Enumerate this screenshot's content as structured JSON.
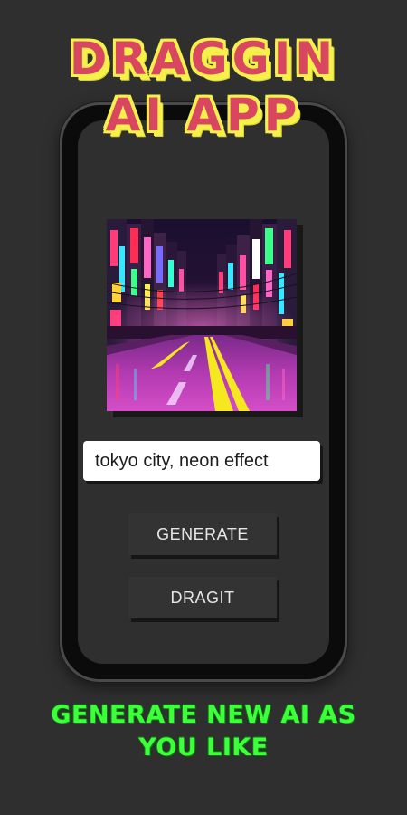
{
  "header": {
    "title_line_1": "DRAGGIN",
    "title_line_2": "AI APP",
    "title_color": "#d94660",
    "title_outline_color": "#f5f14a"
  },
  "preview": {
    "image_subject": "neon city street at night"
  },
  "prompt": {
    "value": "tokyo city, neon effect"
  },
  "buttons": {
    "generate_label": "GENERATE",
    "dragit_label": "DRAGIT"
  },
  "footer": {
    "tagline": "GENERATE NEW AI AS YOU LIKE",
    "tagline_color": "#3dff3a"
  }
}
